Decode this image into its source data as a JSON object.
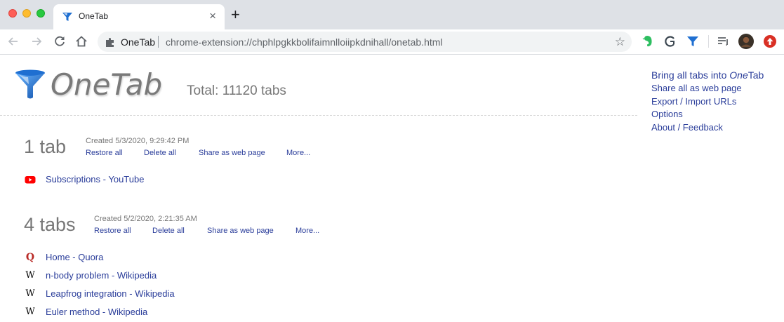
{
  "browser": {
    "tab": {
      "title": "OneTab"
    },
    "omnibox": {
      "source_label": "OneTab",
      "url": "chrome-extension://chphlpgkkbolifaimnlloiipkdnihall/onetab.html"
    },
    "extensions": [
      "evernote-icon",
      "grammarly-icon",
      "onetab-icon",
      "reading-list-icon",
      "profile-avatar",
      "update-icon"
    ]
  },
  "page": {
    "logo_text": "OneTab",
    "total": "Total: 11120 tabs",
    "side_links": {
      "bring_all_prefix": "Bring all tabs into ",
      "bring_all_italic": "One",
      "bring_all_suffix": "Tab",
      "share_all": "Share all as web page",
      "export_import": "Export / Import URLs",
      "options": "Options",
      "about": "About / Feedback"
    },
    "groups": [
      {
        "count": "1 tab",
        "created": "Created 5/3/2020, 9:29:42 PM",
        "actions": {
          "restore": "Restore all",
          "delete": "Delete all",
          "share": "Share as web page",
          "more": "More..."
        },
        "tabs": [
          {
            "title": "Subscriptions - YouTube",
            "favicon": "youtube-icon"
          }
        ]
      },
      {
        "count": "4 tabs",
        "created": "Created 5/2/2020, 2:21:35 AM",
        "actions": {
          "restore": "Restore all",
          "delete": "Delete all",
          "share": "Share as web page",
          "more": "More..."
        },
        "tabs": [
          {
            "title": "Home - Quora",
            "favicon": "quora-icon"
          },
          {
            "title": "n-body problem - Wikipedia",
            "favicon": "wikipedia-icon"
          },
          {
            "title": "Leapfrog integration - Wikipedia",
            "favicon": "wikipedia-icon"
          },
          {
            "title": "Euler method - Wikipedia",
            "favicon": "wikipedia-icon"
          }
        ]
      }
    ]
  },
  "colors": {
    "link": "#2a3d9a",
    "muted_text": "#777777",
    "tabstrip_bg": "#dee1e6",
    "onetab_blue": "#1f6fd1"
  }
}
